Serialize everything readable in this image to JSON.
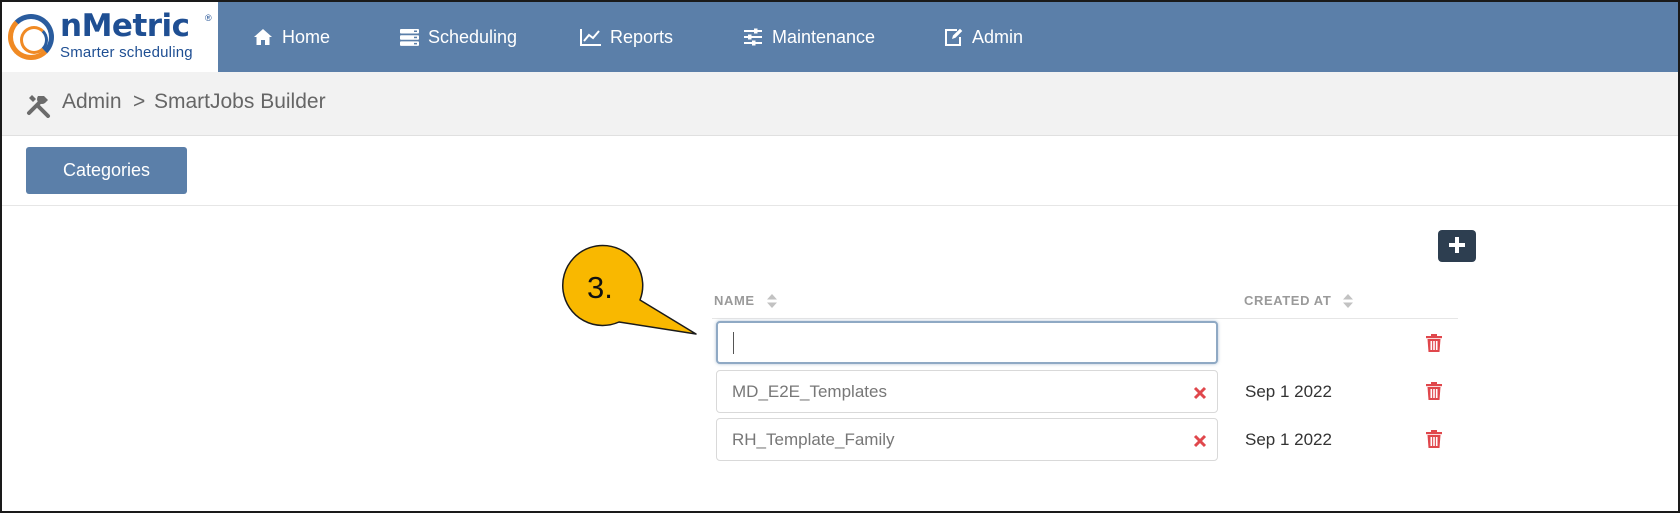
{
  "logo": {
    "name": "nMetric",
    "registered": "®",
    "tagline": "Smarter scheduling"
  },
  "nav": {
    "items": [
      {
        "label": "Home",
        "icon": "home-icon"
      },
      {
        "label": "Scheduling",
        "icon": "server-icon"
      },
      {
        "label": "Reports",
        "icon": "line-chart-icon"
      },
      {
        "label": "Maintenance",
        "icon": "sliders-icon"
      },
      {
        "label": "Admin",
        "icon": "edit-icon"
      }
    ]
  },
  "breadcrumb": {
    "root": "Admin",
    "separator": ">",
    "current": "SmartJobs Builder",
    "icon": "tools-icon"
  },
  "toolbar": {
    "categories_label": "Categories"
  },
  "table": {
    "columns": {
      "name": "NAME",
      "created_at": "CREATED AT"
    },
    "new_row": {
      "value": ""
    },
    "rows": [
      {
        "name": "MD_E2E_Templates",
        "created_at": "Sep 1 2022"
      },
      {
        "name": "RH_Template_Family",
        "created_at": "Sep 1 2022"
      }
    ]
  },
  "annotation": {
    "label": "3.",
    "color": "#f9b800"
  },
  "colors": {
    "nav_bg": "#5b7fa9",
    "add_button_bg": "#2d3e50",
    "danger": "#e0474c"
  }
}
